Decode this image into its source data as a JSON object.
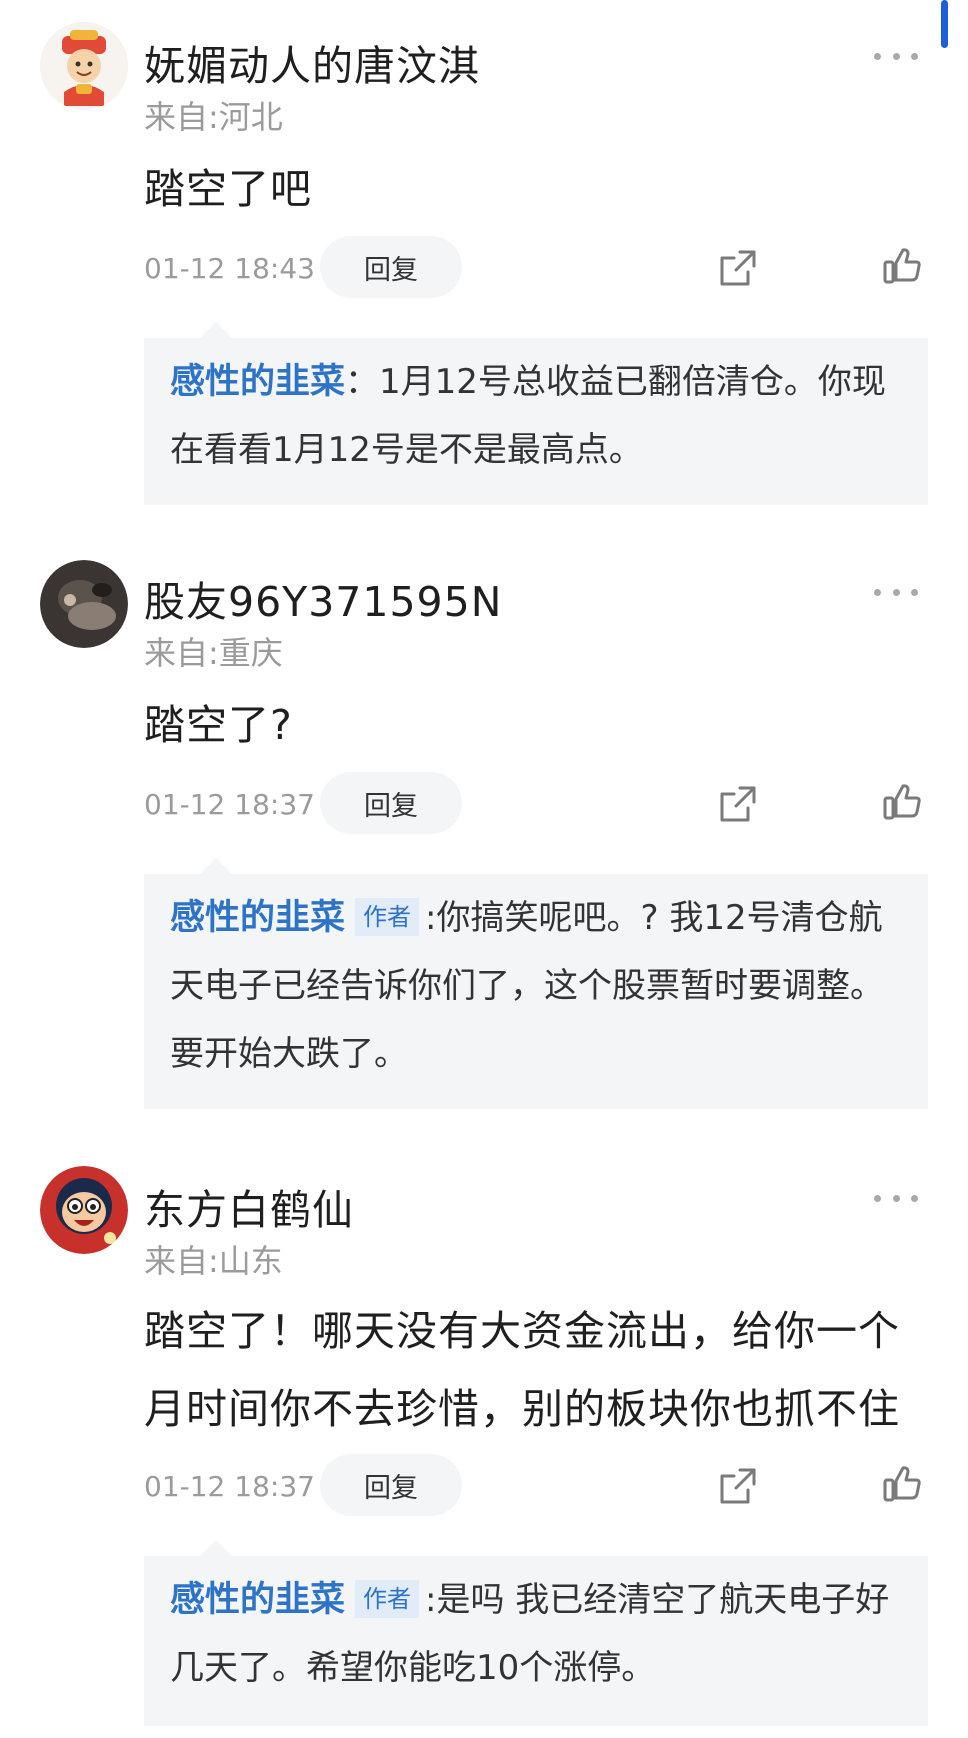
{
  "comments": [
    {
      "username": "妩媚动人的唐汶淇",
      "location": "来自:河北",
      "content": "踏空了吧",
      "time": "01-12 18:43",
      "reply_label": "回复",
      "reply": {
        "author": "感性的韭菜",
        "badge": "",
        "text": "：1月12号总收益已翻倍清仓。你现在看看1月12号是不是最高点。"
      }
    },
    {
      "username": "股友96Y371595N",
      "location": "来自:重庆",
      "content": "踏空了?",
      "time": "01-12 18:37",
      "reply_label": "回复",
      "reply": {
        "author": "感性的韭菜",
        "badge": "作者",
        "text": ":你搞笑呢吧。? 我12号清仓航天电子已经告诉你们了，这个股票暂时要调整。要开始大跌了。"
      }
    },
    {
      "username": "东方白鹤仙",
      "location": "来自:山东",
      "content": "踏空了！哪天没有大资金流出，给你一个月时间你不去珍惜，别的板块你也抓不住",
      "time": "01-12 18:37",
      "reply_label": "回复",
      "reply": {
        "author": "感性的韭菜",
        "badge": "作者",
        "text": ":是吗 我已经清空了航天电子好几天了。希望你能吃10个涨停。"
      }
    }
  ],
  "icons": {
    "more": "more-dots-icon",
    "share": "share-icon",
    "like": "thumbs-up-icon"
  },
  "colors": {
    "accent": "#2d74c9",
    "reply_bg": "#f4f5f7",
    "meta": "#9b9b9b",
    "scroll_indicator": "#1d5fd6"
  }
}
